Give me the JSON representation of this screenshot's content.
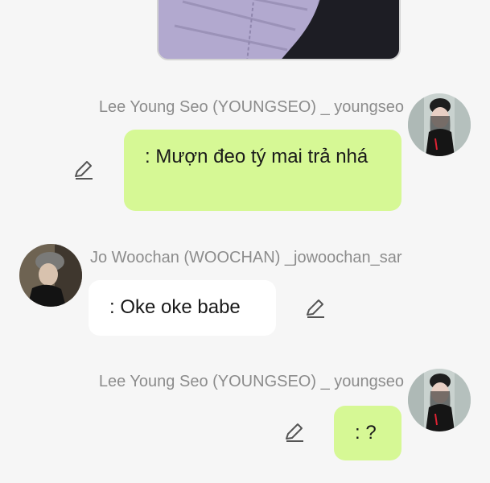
{
  "messages": [
    {
      "sender": "Lee Young Seo (YOUNGSEO) _ youngseo",
      "text": ": Mượn đeo tý mai trả nhá",
      "side": "right",
      "avatar_icon": "girl-avatar-icon",
      "edit_icon": "pencil-icon"
    },
    {
      "sender": "Jo Woochan (WOOCHAN)  _jowoochan_sar",
      "text": ": Oke oke babe",
      "side": "left",
      "avatar_icon": "boy-avatar-icon",
      "edit_icon": "pencil-icon"
    },
    {
      "sender": "Lee Young Seo (YOUNGSEO) _ youngseo",
      "text": ": ?",
      "side": "right",
      "avatar_icon": "girl-avatar-icon",
      "edit_icon": "pencil-icon"
    }
  ],
  "colors": {
    "background": "#f6f6f6",
    "my_bubble": "#d6f895",
    "their_bubble": "#ffffff",
    "sender_text": "#8c8c8c"
  }
}
